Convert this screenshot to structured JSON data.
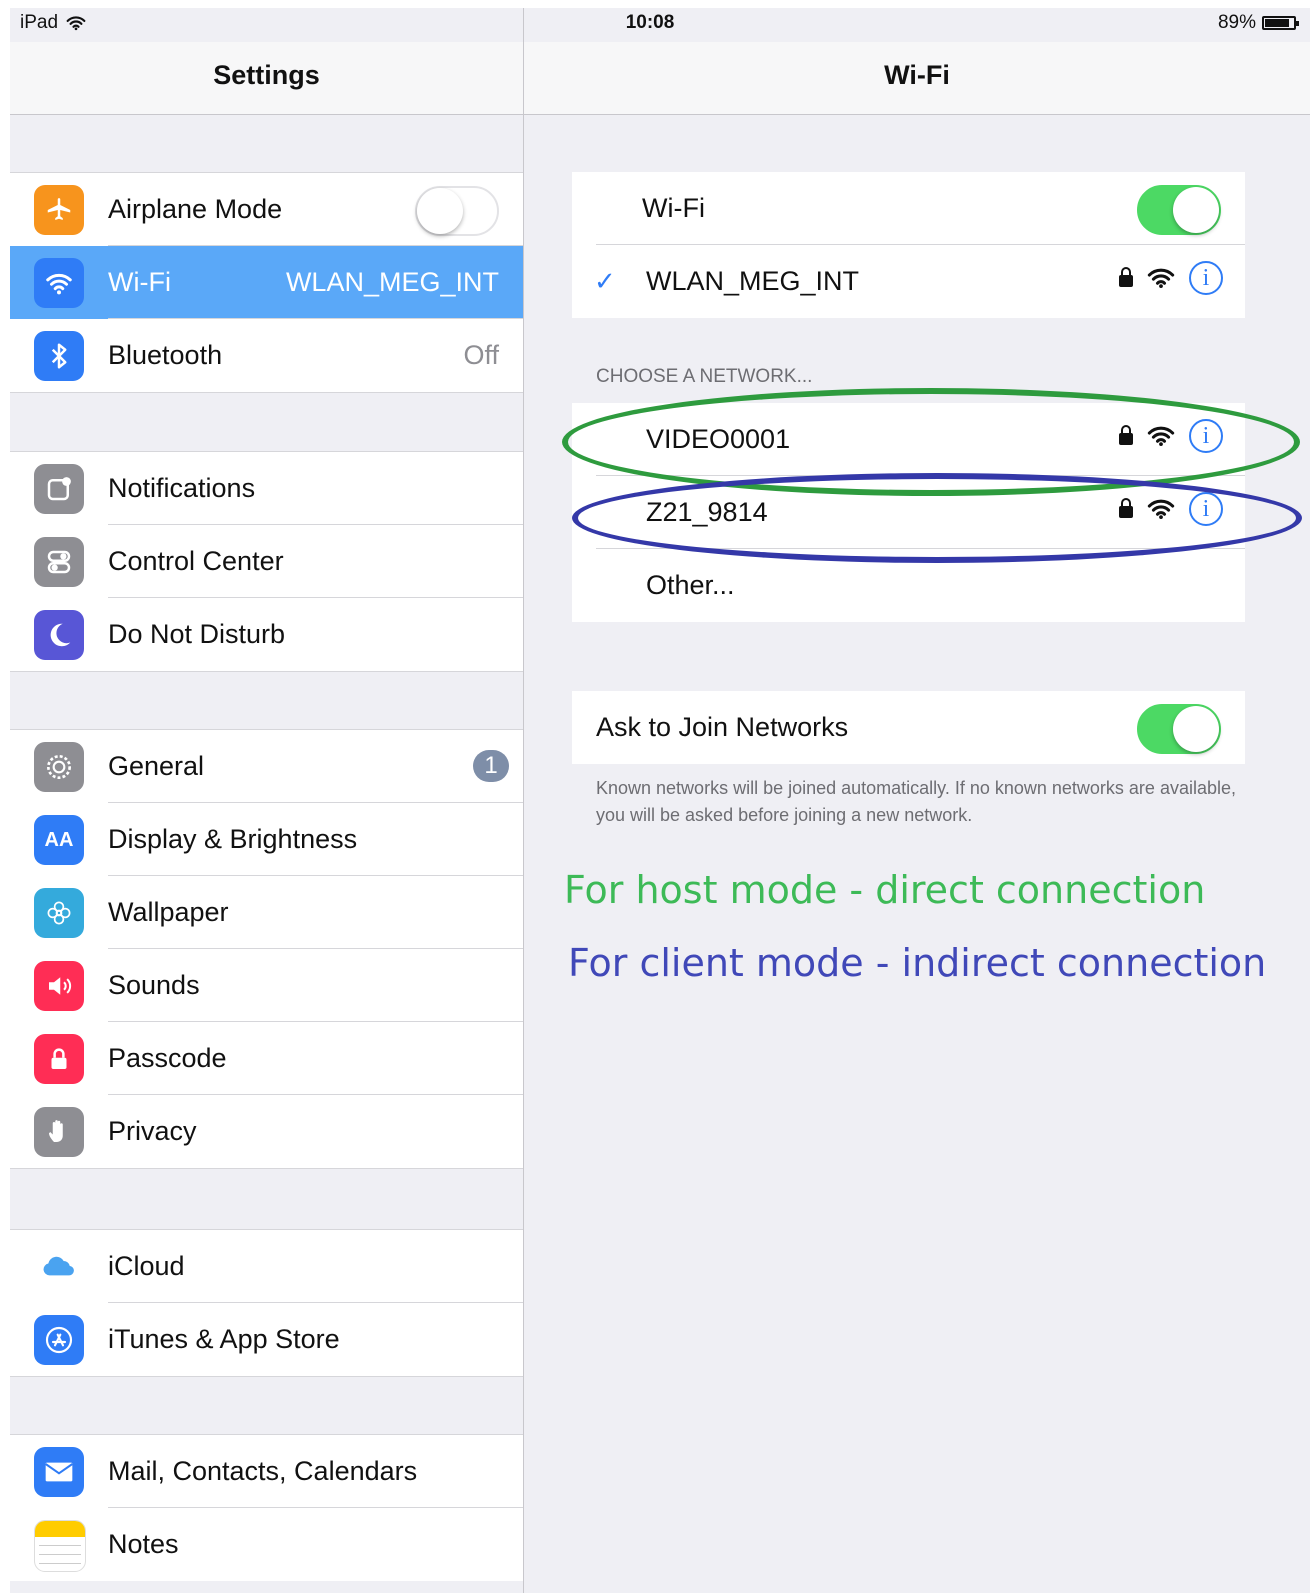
{
  "status_bar": {
    "device": "iPad",
    "time": "10:08",
    "battery": "89%"
  },
  "left": {
    "title": "Settings",
    "groups": [
      [
        {
          "label": "Airplane Mode",
          "icon": "airplane-icon",
          "color": "#f7941d"
        },
        {
          "label": "Wi-Fi",
          "value": "WLAN_MEG_INT",
          "icon": "wifi-icon",
          "color": "#2f7cf6"
        },
        {
          "label": "Bluetooth",
          "value": "Off",
          "icon": "bluetooth-icon",
          "color": "#2f7cf6"
        }
      ],
      [
        {
          "label": "Notifications",
          "icon": "notifications-icon",
          "color": "#8e8e93"
        },
        {
          "label": "Control Center",
          "icon": "control-center-icon",
          "color": "#8e8e93"
        },
        {
          "label": "Do Not Disturb",
          "icon": "moon-icon",
          "color": "#5856d6"
        }
      ],
      [
        {
          "label": "General",
          "badge": "1",
          "icon": "gear-icon",
          "color": "#8e8e93"
        },
        {
          "label": "Display & Brightness",
          "icon": "display-icon",
          "color": "#2f7cf6"
        },
        {
          "label": "Wallpaper",
          "icon": "wallpaper-icon",
          "color": "#34aadc"
        },
        {
          "label": "Sounds",
          "icon": "speaker-icon",
          "color": "#ff2d55"
        },
        {
          "label": "Passcode",
          "icon": "lock-icon",
          "color": "#ff2d55"
        },
        {
          "label": "Privacy",
          "icon": "hand-icon",
          "color": "#8e8e93"
        }
      ],
      [
        {
          "label": "iCloud",
          "icon": "cloud-icon",
          "color": "#ffffff"
        },
        {
          "label": "iTunes & App Store",
          "icon": "app-store-icon",
          "color": "#2f7cf6"
        }
      ],
      [
        {
          "label": "Mail, Contacts, Calendars",
          "icon": "mail-icon",
          "color": "#2f7cf6"
        },
        {
          "label": "Notes",
          "icon": "notes-icon",
          "color": "#ffcc00"
        }
      ]
    ]
  },
  "right": {
    "title": "Wi-Fi",
    "wifi_label": "Wi-Fi",
    "connected_network": "WLAN_MEG_INT",
    "choose_header": "CHOOSE A NETWORK...",
    "networks": [
      "VIDEO0001",
      "Z21_9814"
    ],
    "other_label": "Other...",
    "ask_join_label": "Ask to Join Networks",
    "ask_join_note": "Known networks will be joined automatically. If no known networks are available, you will be asked before joining a new network.",
    "annotation_host": "For host mode - direct connection",
    "annotation_client": "For client mode - indirect connection",
    "annotation_host_color": "#3dba57",
    "annotation_client_color": "#4048b8"
  }
}
